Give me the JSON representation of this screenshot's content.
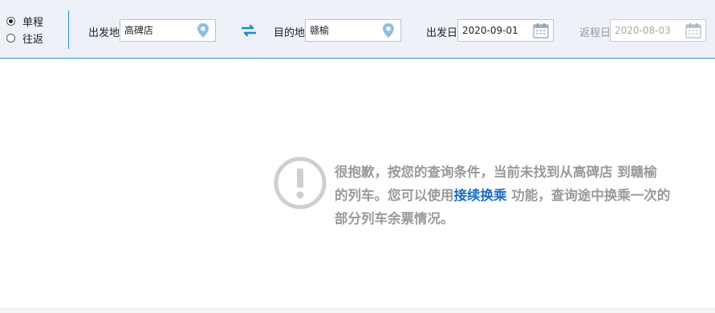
{
  "trip_type": {
    "options": [
      {
        "label": "单程",
        "selected": true
      },
      {
        "label": "往返",
        "selected": false
      }
    ]
  },
  "search": {
    "departure_label": "出发地",
    "departure_value": "高碑店",
    "destination_label": "目的地",
    "destination_value": "赣榆",
    "depart_date_label": "出发日",
    "depart_date_value": "2020-09-01",
    "return_date_label": "返程日",
    "return_date_value": "2020-08-03"
  },
  "icons": {
    "location": "location-pin-icon",
    "calendar": "calendar-icon",
    "swap": "swap-arrows-icon",
    "alert": "exclamation-circle-icon"
  },
  "colors": {
    "accent": "#2b8fc6",
    "link": "#1f6fc0",
    "muted_text": "#9a9a9a",
    "toolbar_bg": "#eef1f8"
  },
  "message": {
    "part1": "很抱歉，按您的查询条件，当前未找到从高碑店 到赣榆 的列车。您可以使用",
    "link": "接续换乘",
    "part2": " 功能，查询途中换乘一次的部分列车余票情况。"
  }
}
